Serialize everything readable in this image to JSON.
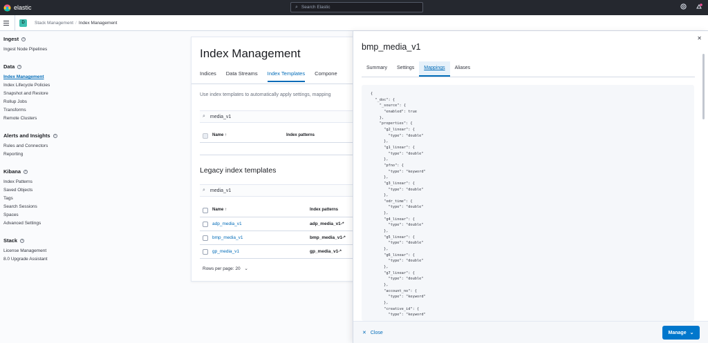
{
  "header": {
    "brand": "elastic",
    "search_placeholder": "Search Elastic",
    "icons": [
      "help-icon",
      "notifications-icon"
    ]
  },
  "breadcrumb": {
    "space_initial": "D",
    "items": [
      "Stack Management",
      "Index Management"
    ]
  },
  "sidebar": {
    "sections": [
      {
        "title": "Ingest",
        "items": [
          "Ingest Node Pipelines"
        ]
      },
      {
        "title": "Data",
        "items": [
          "Index Management",
          "Index Lifecycle Policies",
          "Snapshot and Restore",
          "Rollup Jobs",
          "Transforms",
          "Remote Clusters"
        ]
      },
      {
        "title": "Alerts and Insights",
        "items": [
          "Rules and Connectors",
          "Reporting"
        ]
      },
      {
        "title": "Kibana",
        "items": [
          "Index Patterns",
          "Saved Objects",
          "Tags",
          "Search Sessions",
          "Spaces",
          "Advanced Settings"
        ]
      },
      {
        "title": "Stack",
        "items": [
          "License Management",
          "8.0 Upgrade Assistant"
        ]
      }
    ],
    "active_item": "Index Management"
  },
  "main": {
    "title": "Index Management",
    "tabs": [
      "Indices",
      "Data Streams",
      "Index Templates",
      "Compone"
    ],
    "selected_tab": "Index Templates",
    "description": "Use index templates to automatically apply settings, mapping",
    "templates_filter": "media_v1",
    "templates_columns": {
      "name": "Name ↑",
      "patterns": "Index patterns"
    },
    "legacy_title": "Legacy index templates",
    "legacy_filter": "media_v1",
    "legacy_columns": {
      "name": "Name ↑",
      "patterns": "Index patterns"
    },
    "legacy_rows": [
      {
        "name": "adp_media_v1",
        "pattern": "adp_media_v1-*"
      },
      {
        "name": "bmp_media_v1",
        "pattern": "bmp_media_v1-*"
      },
      {
        "name": "gp_media_v1",
        "pattern": "gp_media_v1-*"
      }
    ],
    "rows_per_page": "Rows per page: 20"
  },
  "flyout": {
    "title": "bmp_media_v1",
    "tabs": [
      "Summary",
      "Settings",
      "Mappings",
      "Aliases"
    ],
    "selected_tab": "Mappings",
    "mappings_json": "{\n  \"_doc\": {\n    \"_source\": {\n      \"enabled\": true\n    },\n    \"properties\": {\n      \"g2_linear\": {\n        \"type\": \"double\"\n      },\n      \"g1_linear\": {\n        \"type\": \"double\"\n      },\n      \"pfno\": {\n        \"type\": \"keyword\"\n      },\n      \"g3_linear\": {\n        \"type\": \"double\"\n      },\n      \"odr_time\": {\n        \"type\": \"double\"\n      },\n      \"g4_linear\": {\n        \"type\": \"double\"\n      },\n      \"g5_linear\": {\n        \"type\": \"double\"\n      },\n      \"g6_linear\": {\n        \"type\": \"double\"\n      },\n      \"g7_linear\": {\n        \"type\": \"double\"\n      },\n      \"account_no\": {\n        \"type\": \"keyword\"\n      },\n      \"creative_id\": {\n        \"type\": \"keyword\"",
    "close_label": "Close",
    "manage_label": "Manage"
  },
  "colors": {
    "accent": "#006bb8",
    "header_bg": "#25282f",
    "primary_button": "#0077cc"
  }
}
